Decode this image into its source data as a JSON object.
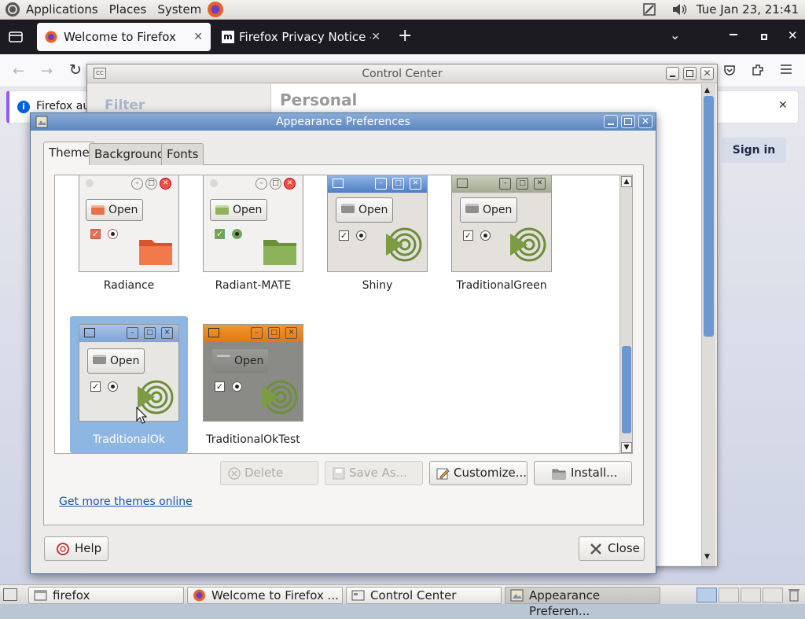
{
  "top_panel": {
    "menus": [
      "Applications",
      "Places",
      "System"
    ],
    "clock": "Tue Jan 23, 21:41"
  },
  "firefox": {
    "tabs": [
      {
        "label": "Welcome to Firefox"
      },
      {
        "label": "Firefox Privacy Notice —"
      }
    ],
    "notice_text": "Firefox au",
    "sign_in": "Sign in"
  },
  "control_center": {
    "title": "Control Center",
    "filter_label": "Filter",
    "section_heading": "Personal"
  },
  "appearance": {
    "title": "Appearance Preferences",
    "tabs": [
      "Theme",
      "Background",
      "Fonts"
    ],
    "themes": [
      {
        "name": "Radiance",
        "open_label": "Open"
      },
      {
        "name": "Radiant-MATE",
        "open_label": "Open"
      },
      {
        "name": "Shiny",
        "open_label": "Open"
      },
      {
        "name": "TraditionalGreen",
        "open_label": "Open"
      },
      {
        "name": "TraditionalOk",
        "open_label": "Open"
      },
      {
        "name": "TraditionalOkTest",
        "open_label": "Open"
      }
    ],
    "selected_theme": "TraditionalOk",
    "buttons": {
      "delete": "Delete",
      "save_as": "Save As...",
      "customize": "Customize...",
      "install": "Install..."
    },
    "get_more_link": "Get more themes online",
    "help": "Help",
    "close": "Close"
  },
  "taskbar": {
    "items": [
      {
        "label": "firefox"
      },
      {
        "label": "Welcome to Firefox ..."
      },
      {
        "label": "Control Center"
      },
      {
        "label": "Appearance Preferen..."
      }
    ]
  },
  "colors": {
    "selection": "#8eb6e2",
    "dialog_title": "#5b86c0",
    "link": "#1a4fb0",
    "firefox_tabbar": "#1c1b22"
  }
}
